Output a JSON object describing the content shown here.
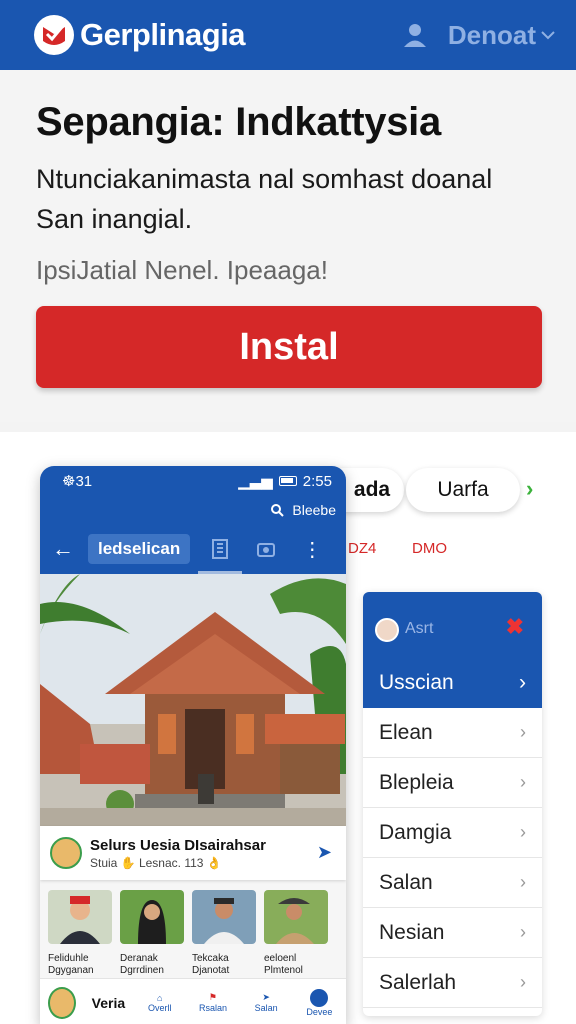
{
  "appbar": {
    "brand": "Gerplinagia",
    "account": "Denoat",
    "colors": {
      "bar": "#1a56b0",
      "logo": "#d52828"
    }
  },
  "hero": {
    "title": "Sepangia: Indkattysia",
    "description_line1": "Ntunciakanimasta nal somhast doanal",
    "description_line2": "San inangial.",
    "subtitle": "IpsiJatial Nenel. Ipeaaga!",
    "install_label": "Instal",
    "install_color": "#d52828"
  },
  "chips": {
    "chip1": "ada",
    "chip2": "Uarfa",
    "code1": "DZ4",
    "code2": "DMO"
  },
  "side_menu": {
    "user": "Asrt",
    "active_item": "Usscian",
    "items": [
      "Elean",
      "Blepleia",
      "Damgia",
      "Salan",
      "Nesian",
      "Salerlah"
    ]
  },
  "phone": {
    "status_time": "☸31",
    "status_right": "2:55",
    "subbar_label": "Bleebe",
    "nav_title": "ledselican",
    "info_title": "Selurs Uesia DIsairahsar",
    "info_sub": "Stuia ✋  Lesnac. 113 👌",
    "thumbs": [
      {
        "line1": "Feliduhle",
        "line2": "Dgyganan"
      },
      {
        "line1": "Deranak",
        "line2": "Dgrrdinen"
      },
      {
        "line1": "Tekcaka",
        "line2": "Djanotat"
      },
      {
        "line1": "eeloenl",
        "line2": "Plmtenol"
      }
    ],
    "bottom_label": "Veria",
    "bottom_items": [
      "Overll",
      "Rsalan",
      "Salan",
      "Devee"
    ]
  }
}
